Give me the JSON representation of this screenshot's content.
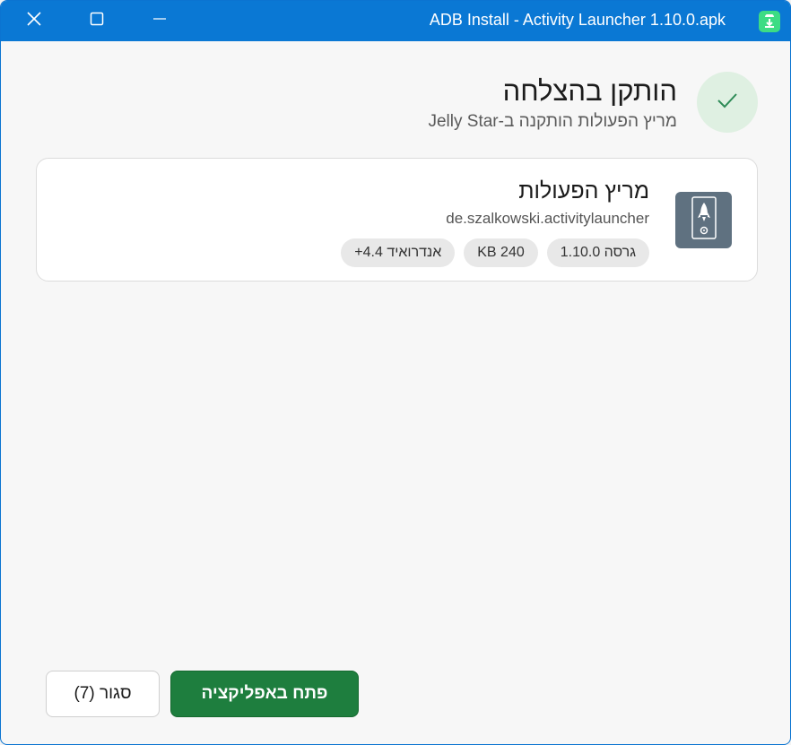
{
  "window": {
    "title": "ADB Install - Activity Launcher 1.10.0.apk",
    "title_bar_color": "#0a78d4"
  },
  "title_bar_controls": {
    "close_icon": "close-icon",
    "maximize_icon": "maximize-icon",
    "minimize_icon": "minimize-icon"
  },
  "header": {
    "status_icon": "checkmark-icon",
    "title": "הותקן בהצלחה",
    "subtitle": "מריץ הפעולות הותקנה ב-Jelly Star"
  },
  "app_card": {
    "icon": "rocket-icon",
    "name": "מריץ הפעולות",
    "package": "de.szalkowski.activitylauncher",
    "chips": {
      "version": "גרסה 1.10.0",
      "size": "240 KB",
      "min_android": "אנדרואיד 4.4+"
    }
  },
  "footer": {
    "close_button": "סגור (7)",
    "open_button": "פתח באפליקציה",
    "accent_color": "#1e7e3e"
  }
}
